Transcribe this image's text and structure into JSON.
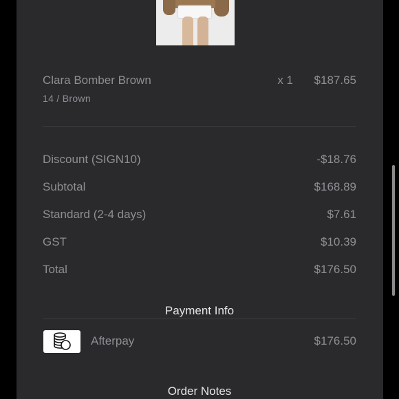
{
  "order_item": {
    "name": "Clara Bomber Brown",
    "variant": "14 / Brown",
    "quantity": "x 1",
    "price": "$187.65"
  },
  "summary": [
    {
      "label": "Discount (SIGN10)",
      "value": "-$18.76"
    },
    {
      "label": "Subtotal",
      "value": "$168.89"
    },
    {
      "label": "Standard (2-4 days)",
      "value": "$7.61"
    },
    {
      "label": "GST",
      "value": "$10.39"
    },
    {
      "label": "Total",
      "value": "$176.50"
    }
  ],
  "payment_info": {
    "title": "Payment Info",
    "method": "Afterpay",
    "amount": "$176.50",
    "icon": "coins-stack-icon"
  },
  "order_notes": {
    "title": "Order Notes"
  },
  "colors": {
    "background": "#000000",
    "panel": "#2a2a2d",
    "text_muted": "#8e8e93",
    "text_heading": "#e6e6e6",
    "divider": "#3c3c40"
  }
}
